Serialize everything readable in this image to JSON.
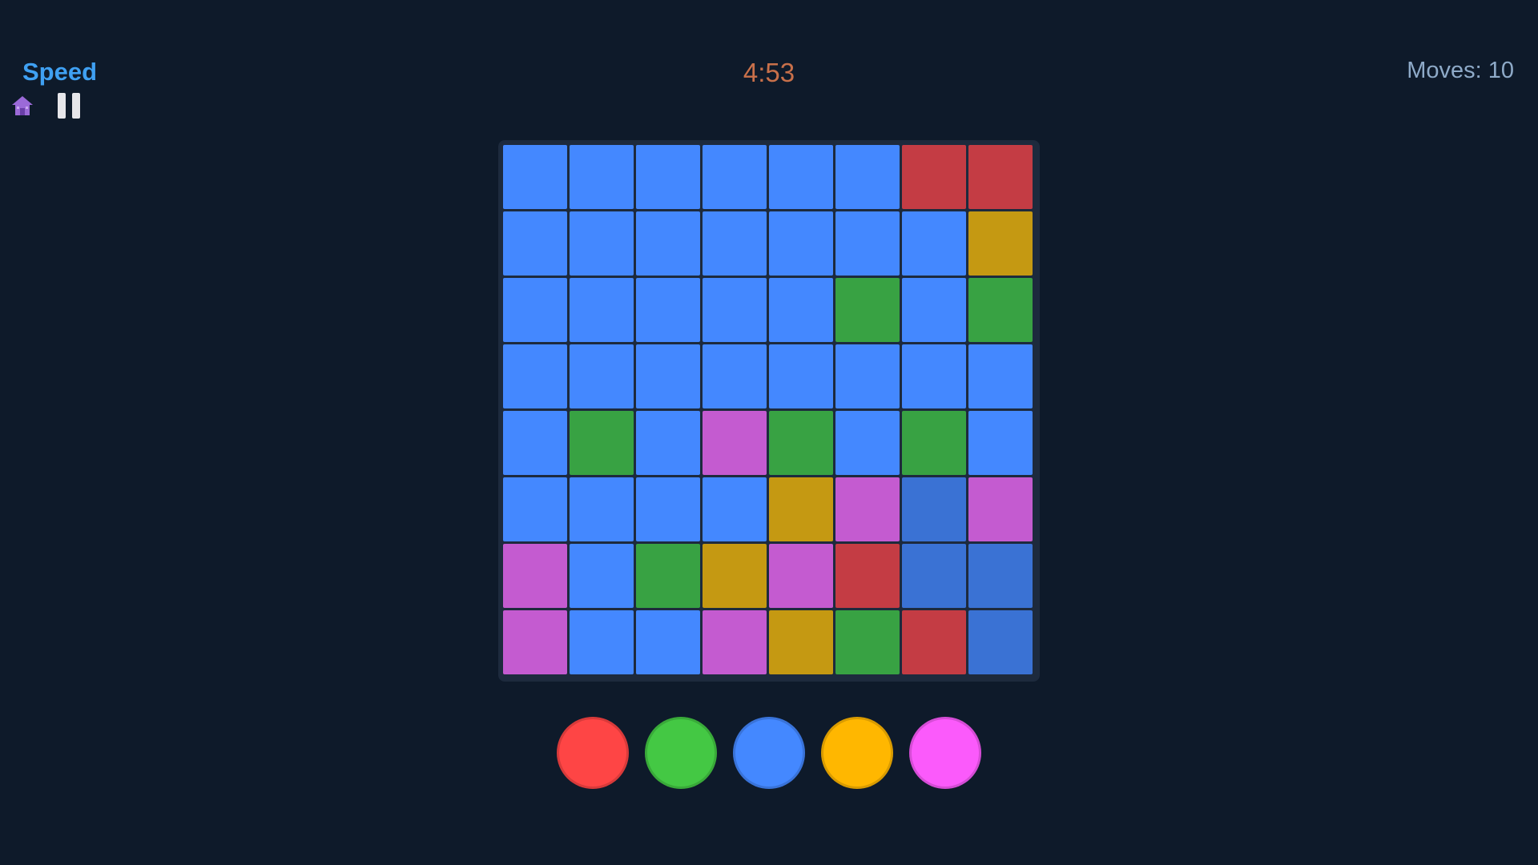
{
  "header": {
    "mode_title": "Speed",
    "timer": "4:53",
    "moves": "Moves: 10",
    "home_icon": "home-icon",
    "pause_icon": "pause-icon"
  },
  "colors": {
    "background": "#0e1a2a",
    "R": "#c43c44",
    "Y": "#c59912",
    "G": "#38a243",
    "B": "#4488ff",
    "M": "#c45bd0",
    "D": "#3a72d4"
  },
  "board": {
    "rows": 8,
    "cols": 8,
    "grid": [
      [
        "B",
        "B",
        "B",
        "B",
        "B",
        "B",
        "R",
        "R"
      ],
      [
        "B",
        "B",
        "B",
        "B",
        "B",
        "B",
        "B",
        "Y"
      ],
      [
        "B",
        "B",
        "B",
        "B",
        "B",
        "G",
        "B",
        "G"
      ],
      [
        "B",
        "B",
        "B",
        "B",
        "B",
        "B",
        "B",
        "B"
      ],
      [
        "B",
        "G",
        "B",
        "M",
        "G",
        "B",
        "G",
        "B"
      ],
      [
        "B",
        "B",
        "B",
        "B",
        "Y",
        "M",
        "D",
        "M"
      ],
      [
        "M",
        "B",
        "G",
        "Y",
        "M",
        "R",
        "D",
        "D"
      ],
      [
        "M",
        "B",
        "B",
        "M",
        "Y",
        "G",
        "R",
        "D"
      ]
    ]
  },
  "palette": [
    {
      "name": "red",
      "color": "#fe4545"
    },
    {
      "name": "green",
      "color": "#44c844"
    },
    {
      "name": "blue",
      "color": "#4488ff"
    },
    {
      "name": "orange",
      "color": "#ffb700"
    },
    {
      "name": "magenta",
      "color": "#fb5afb"
    }
  ]
}
